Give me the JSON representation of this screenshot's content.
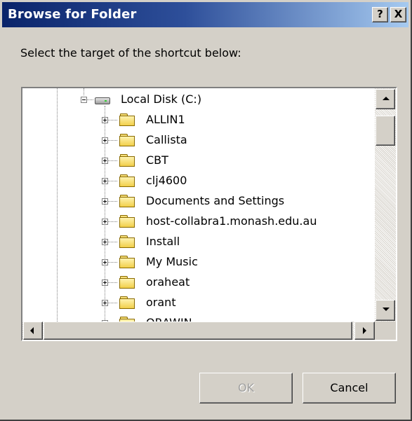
{
  "window": {
    "title": "Browse for Folder",
    "help_label": "?",
    "close_label": "X"
  },
  "prompt": "Select the target of the shortcut below:",
  "tree": {
    "root": {
      "label": "Local Disk (C:)",
      "icon": "drive-icon",
      "expanded": true
    },
    "items": [
      {
        "label": "ALLIN1",
        "icon": "folder-icon"
      },
      {
        "label": "Callista",
        "icon": "folder-icon"
      },
      {
        "label": "CBT",
        "icon": "folder-icon"
      },
      {
        "label": "clj4600",
        "icon": "folder-icon"
      },
      {
        "label": "Documents and Settings",
        "icon": "folder-icon"
      },
      {
        "label": "host-collabra1.monash.edu.au",
        "icon": "folder-icon"
      },
      {
        "label": "Install",
        "icon": "folder-icon"
      },
      {
        "label": "My Music",
        "icon": "folder-icon"
      },
      {
        "label": "oraheat",
        "icon": "folder-icon"
      },
      {
        "label": "orant",
        "icon": "folder-icon"
      },
      {
        "label": "ORAWIN",
        "icon": "folder-icon"
      }
    ]
  },
  "buttons": {
    "ok": "OK",
    "cancel": "Cancel"
  },
  "colors": {
    "titlebar_start": "#0a246a",
    "titlebar_end": "#a6caf0",
    "face": "#d4d0c8",
    "disabled_text": "#a0a0a0"
  }
}
